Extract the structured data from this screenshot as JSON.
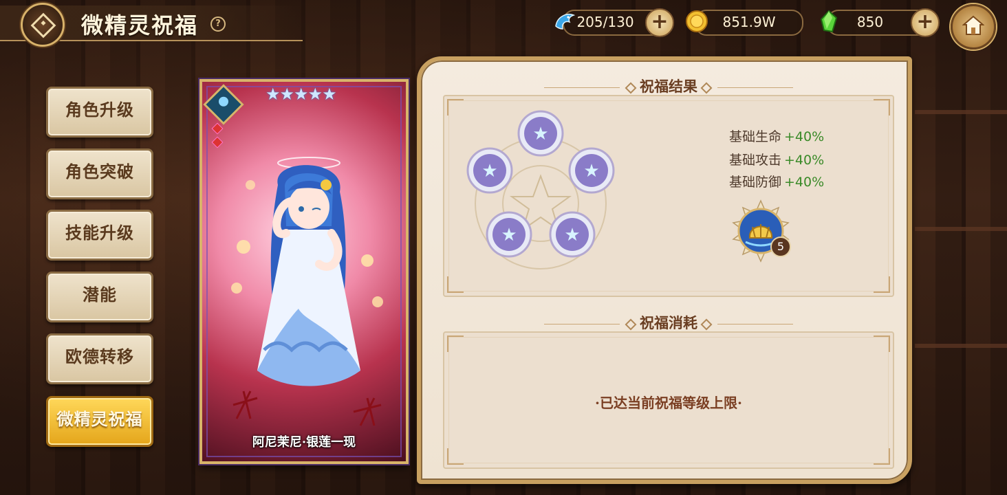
{
  "header": {
    "title": "微精灵祝福",
    "help": "?"
  },
  "resources": [
    {
      "icon": "dolphin-stamina-icon",
      "value": "205/130"
    },
    {
      "icon": "gold-coin-icon",
      "value": "851.9W"
    },
    {
      "icon": "green-crystal-icon",
      "value": "850"
    }
  ],
  "menu": {
    "items": [
      {
        "label": "角色升级"
      },
      {
        "label": "角色突破"
      },
      {
        "label": "技能升级"
      },
      {
        "label": "潜能"
      },
      {
        "label": "欧德转移"
      },
      {
        "label": "微精灵祝福",
        "active": true
      }
    ]
  },
  "card": {
    "name": "阿尼茉尼·银莲一现",
    "stars": "★★★★★",
    "star_count": 5
  },
  "result": {
    "title": "祝福结果",
    "stats": [
      {
        "label": "基础生命",
        "bonus": "+40%"
      },
      {
        "label": "基础攻击",
        "bonus": "+40%"
      },
      {
        "label": "基础防御",
        "bonus": "+40%"
      }
    ],
    "shell_level": "5"
  },
  "cost": {
    "title": "祝福消耗",
    "message": "·已达当前祝福等级上限·"
  },
  "colors": {
    "accent_gold": "#d8b46a",
    "bonus_green": "#3a8a28",
    "active_button": "#f0b52a"
  }
}
